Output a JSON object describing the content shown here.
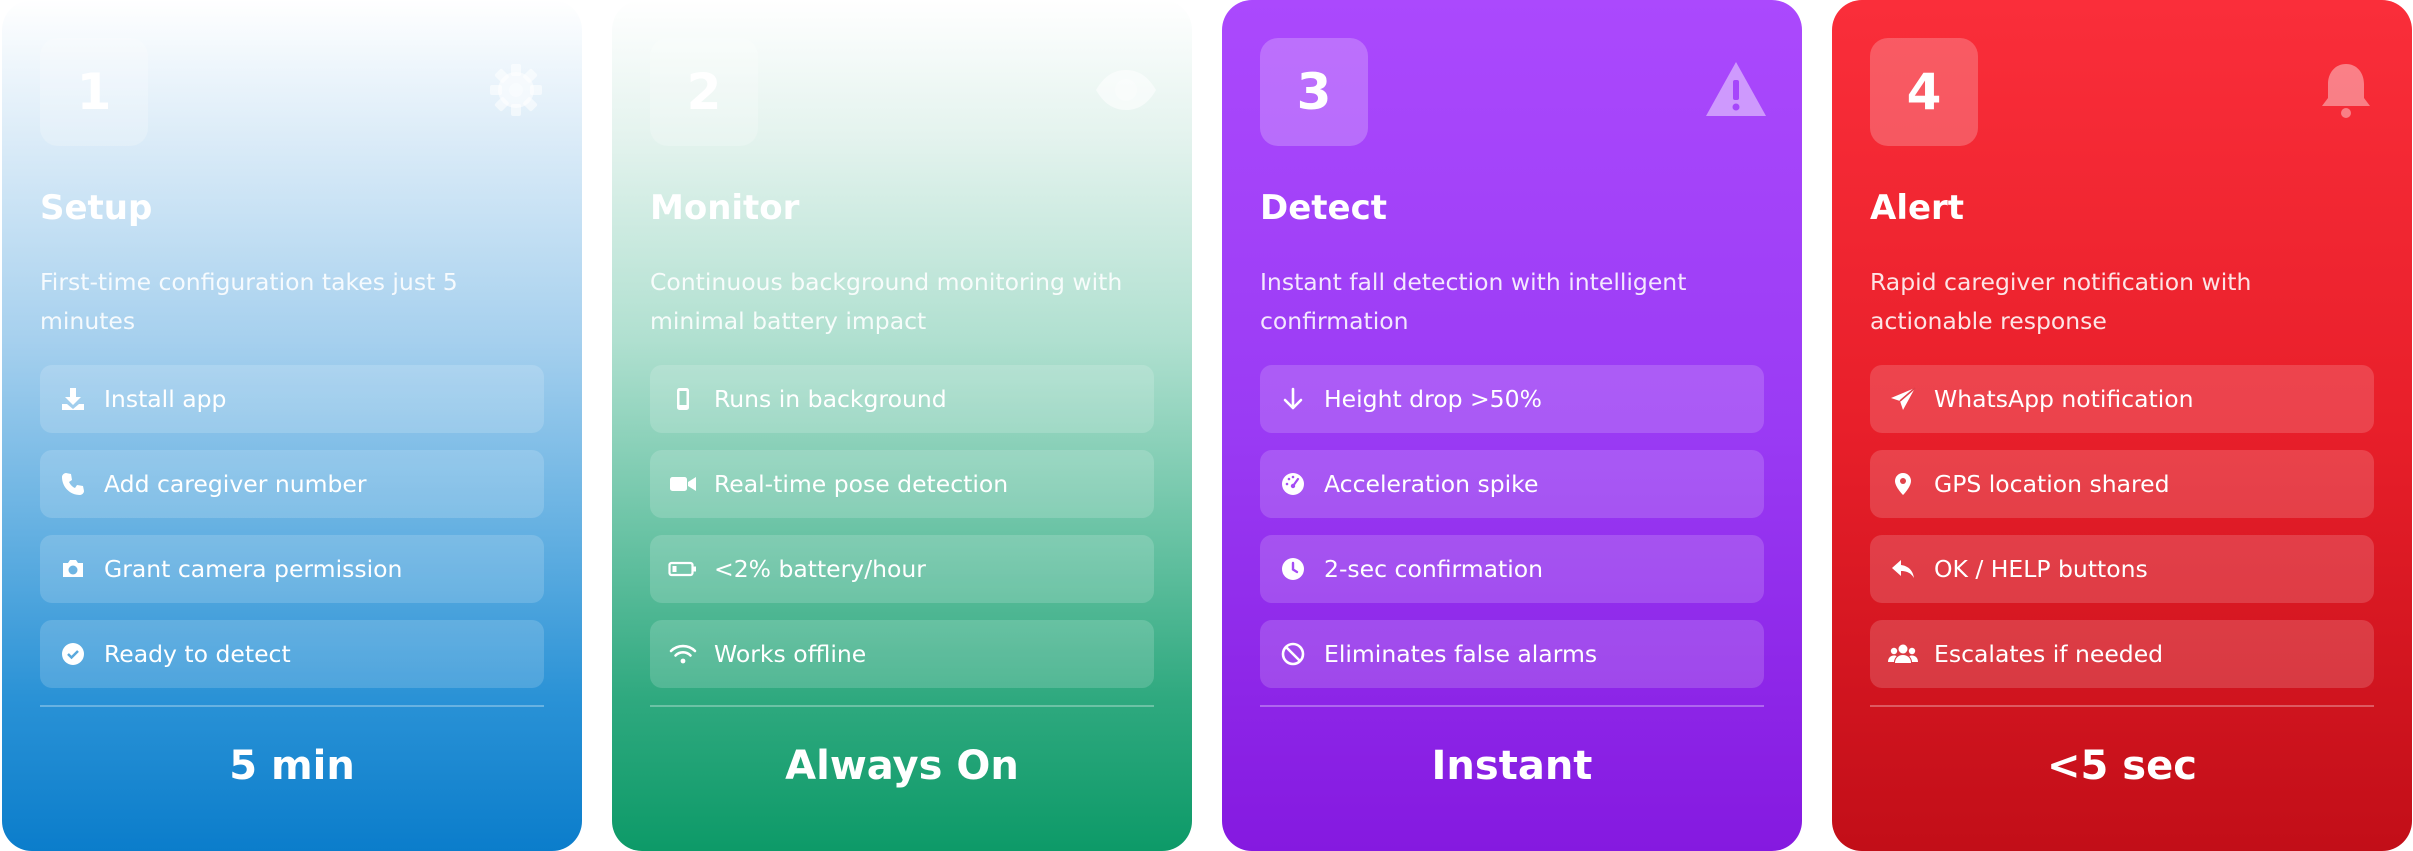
{
  "cards": [
    {
      "number": "1",
      "top_icon": "gear-icon",
      "title": "Setup",
      "description": "First-time configuration takes just 5 minutes",
      "items": [
        {
          "icon": "download-icon",
          "label": "Install app"
        },
        {
          "icon": "phone-icon",
          "label": "Add caregiver number"
        },
        {
          "icon": "camera-icon",
          "label": "Grant camera permission"
        },
        {
          "icon": "check-circle-icon",
          "label": "Ready to detect"
        }
      ],
      "stat": "5 min",
      "color": "#0b7dcb"
    },
    {
      "number": "2",
      "top_icon": "eye-icon",
      "title": "Monitor",
      "description": "Continuous background monitoring with minimal battery impact",
      "items": [
        {
          "icon": "mobile-icon",
          "label": "Runs in background"
        },
        {
          "icon": "video-icon",
          "label": "Real-time pose detection"
        },
        {
          "icon": "battery-icon",
          "label": "<2% battery/hour"
        },
        {
          "icon": "wifi-icon",
          "label": "Works offline"
        }
      ],
      "stat": "Always On",
      "color": "#0d9a68"
    },
    {
      "number": "3",
      "top_icon": "warning-icon",
      "title": "Detect",
      "description": "Instant fall detection with intelligent confirmation",
      "items": [
        {
          "icon": "arrow-down-icon",
          "label": "Height drop >50%"
        },
        {
          "icon": "gauge-icon",
          "label": "Acceleration spike"
        },
        {
          "icon": "clock-icon",
          "label": "2-sec confirmation"
        },
        {
          "icon": "ban-icon",
          "label": "Eliminates false alarms"
        }
      ],
      "stat": "Instant",
      "color": "#9a3bf4"
    },
    {
      "number": "4",
      "top_icon": "bell-icon",
      "title": "Alert",
      "description": "Rapid caregiver notification with actionable response",
      "items": [
        {
          "icon": "send-icon",
          "label": "WhatsApp notification"
        },
        {
          "icon": "location-pin-icon",
          "label": "GPS location shared"
        },
        {
          "icon": "reply-icon",
          "label": "OK / HELP buttons"
        },
        {
          "icon": "users-icon",
          "label": "Escalates if needed"
        }
      ],
      "stat": "<5 sec",
      "color": "#e81f2a"
    }
  ]
}
